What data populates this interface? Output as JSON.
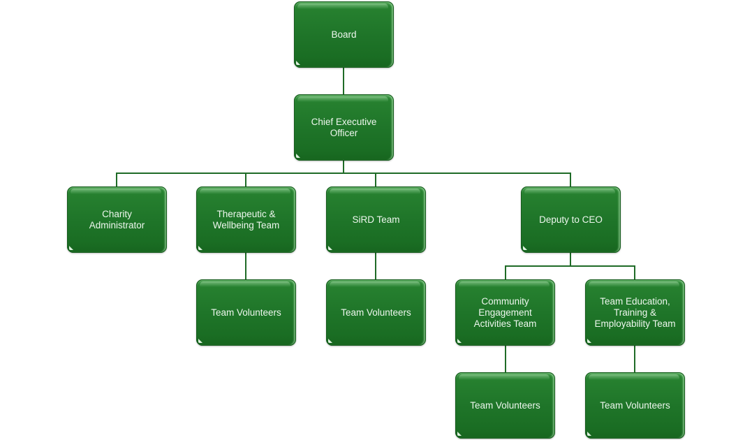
{
  "diagram": {
    "type": "org-chart",
    "colors": {
      "box_fill": "#1f7529",
      "box_text": "#eef7ee",
      "connector": "#1f6b27",
      "background": "#ffffff"
    },
    "nodes": {
      "board": {
        "label": "Board"
      },
      "ceo": {
        "label": "Chief Executive\nOfficer"
      },
      "charity_admin": {
        "label": "Charity\nAdministrator"
      },
      "therapeutic": {
        "label": "Therapeutic &\nWellbeing Team"
      },
      "sird": {
        "label": "SiRD Team"
      },
      "deputy": {
        "label": "Deputy to CEO"
      },
      "therapeutic_volunteers": {
        "label": "Team Volunteers"
      },
      "sird_volunteers": {
        "label": "Team Volunteers"
      },
      "community": {
        "label": "Community\nEngagement\nActivities Team"
      },
      "education": {
        "label": "Team Education,\nTraining &\nEmployability Team"
      },
      "community_volunteers": {
        "label": "Team Volunteers"
      },
      "education_volunteers": {
        "label": "Team Volunteers"
      }
    },
    "edges": [
      [
        "board",
        "ceo"
      ],
      [
        "ceo",
        "charity_admin"
      ],
      [
        "ceo",
        "therapeutic"
      ],
      [
        "ceo",
        "sird"
      ],
      [
        "ceo",
        "deputy"
      ],
      [
        "therapeutic",
        "therapeutic_volunteers"
      ],
      [
        "sird",
        "sird_volunteers"
      ],
      [
        "deputy",
        "community"
      ],
      [
        "deputy",
        "education"
      ],
      [
        "community",
        "community_volunteers"
      ],
      [
        "education",
        "education_volunteers"
      ]
    ]
  }
}
